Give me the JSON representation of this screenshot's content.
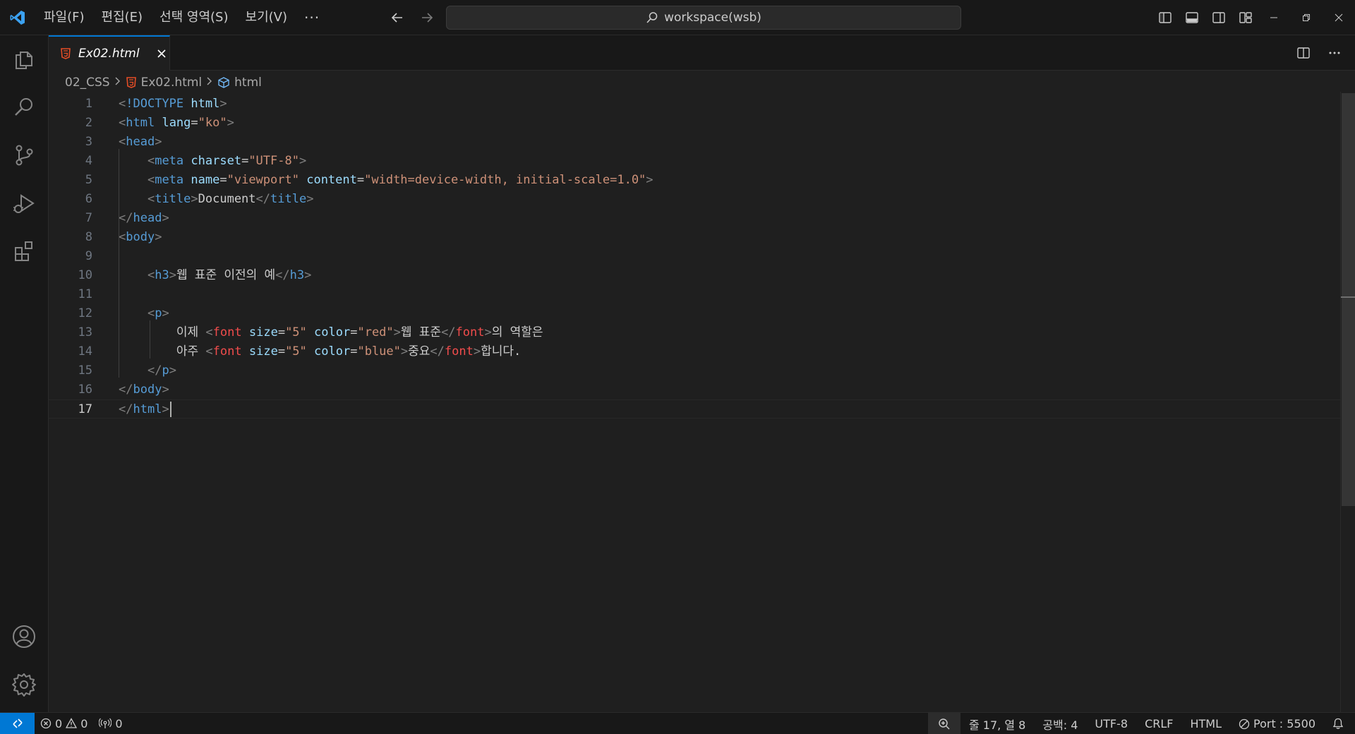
{
  "titlebar": {
    "menu": [
      "파일(F)",
      "편집(E)",
      "선택 영역(S)",
      "보기(V)"
    ],
    "more": "···",
    "search": "workspace(wsb)"
  },
  "tabs": [
    {
      "label": "Ex02.html",
      "icon": "html5-icon",
      "active": true
    }
  ],
  "breadcrumb": [
    "02_CSS",
    "Ex02.html",
    "html"
  ],
  "editor": {
    "current_line": 17,
    "lines": [
      {
        "n": "1"
      },
      {
        "n": "2"
      },
      {
        "n": "3"
      },
      {
        "n": "4"
      },
      {
        "n": "5"
      },
      {
        "n": "6"
      },
      {
        "n": "7"
      },
      {
        "n": "8"
      },
      {
        "n": "9"
      },
      {
        "n": "10"
      },
      {
        "n": "11"
      },
      {
        "n": "12"
      },
      {
        "n": "13"
      },
      {
        "n": "14"
      },
      {
        "n": "15"
      },
      {
        "n": "16"
      },
      {
        "n": "17"
      }
    ],
    "code": [
      [
        [
          "punc",
          "<"
        ],
        [
          "tag",
          "!DOCTYPE"
        ],
        [
          "txt",
          " "
        ],
        [
          "attr",
          "html"
        ],
        [
          "punc",
          ">"
        ]
      ],
      [
        [
          "punc",
          "<"
        ],
        [
          "tag",
          "html"
        ],
        [
          "txt",
          " "
        ],
        [
          "attr",
          "lang"
        ],
        [
          "txt",
          "="
        ],
        [
          "str",
          "\"ko\""
        ],
        [
          "punc",
          ">"
        ]
      ],
      [
        [
          "punc",
          "<"
        ],
        [
          "tag",
          "head"
        ],
        [
          "punc",
          ">"
        ]
      ],
      [
        [
          "txt",
          "    "
        ],
        [
          "punc",
          "<"
        ],
        [
          "tag",
          "meta"
        ],
        [
          "txt",
          " "
        ],
        [
          "attr",
          "charset"
        ],
        [
          "txt",
          "="
        ],
        [
          "str",
          "\"UTF-8\""
        ],
        [
          "punc",
          ">"
        ]
      ],
      [
        [
          "txt",
          "    "
        ],
        [
          "punc",
          "<"
        ],
        [
          "tag",
          "meta"
        ],
        [
          "txt",
          " "
        ],
        [
          "attr",
          "name"
        ],
        [
          "txt",
          "="
        ],
        [
          "str",
          "\"viewport\""
        ],
        [
          "txt",
          " "
        ],
        [
          "attr",
          "content"
        ],
        [
          "txt",
          "="
        ],
        [
          "str",
          "\"width=device-width, initial-scale=1.0\""
        ],
        [
          "punc",
          ">"
        ]
      ],
      [
        [
          "txt",
          "    "
        ],
        [
          "punc",
          "<"
        ],
        [
          "tag",
          "title"
        ],
        [
          "punc",
          ">"
        ],
        [
          "txt",
          "Document"
        ],
        [
          "punc",
          "</"
        ],
        [
          "tag",
          "title"
        ],
        [
          "punc",
          ">"
        ]
      ],
      [
        [
          "punc",
          "</"
        ],
        [
          "tag",
          "head"
        ],
        [
          "punc",
          ">"
        ]
      ],
      [
        [
          "punc",
          "<"
        ],
        [
          "tag",
          "body"
        ],
        [
          "punc",
          ">"
        ]
      ],
      [
        [
          "txt",
          ""
        ]
      ],
      [
        [
          "txt",
          "    "
        ],
        [
          "punc",
          "<"
        ],
        [
          "tag",
          "h3"
        ],
        [
          "punc",
          ">"
        ],
        [
          "txt",
          "웹 표준 이전의 예"
        ],
        [
          "punc",
          "</"
        ],
        [
          "tag",
          "h3"
        ],
        [
          "punc",
          ">"
        ]
      ],
      [
        [
          "txt",
          ""
        ]
      ],
      [
        [
          "txt",
          "    "
        ],
        [
          "punc",
          "<"
        ],
        [
          "tag",
          "p"
        ],
        [
          "punc",
          ">"
        ]
      ],
      [
        [
          "txt",
          "        이제 "
        ],
        [
          "punc",
          "<"
        ],
        [
          "red",
          "font"
        ],
        [
          "txt",
          " "
        ],
        [
          "attr",
          "size"
        ],
        [
          "txt",
          "="
        ],
        [
          "str",
          "\"5\""
        ],
        [
          "txt",
          " "
        ],
        [
          "attr",
          "color"
        ],
        [
          "txt",
          "="
        ],
        [
          "str",
          "\"red\""
        ],
        [
          "punc",
          ">"
        ],
        [
          "txt",
          "웹 표준"
        ],
        [
          "punc",
          "</"
        ],
        [
          "red",
          "font"
        ],
        [
          "punc",
          ">"
        ],
        [
          "txt",
          "의 역할은"
        ]
      ],
      [
        [
          "txt",
          "        아주 "
        ],
        [
          "punc",
          "<"
        ],
        [
          "red",
          "font"
        ],
        [
          "txt",
          " "
        ],
        [
          "attr",
          "size"
        ],
        [
          "txt",
          "="
        ],
        [
          "str",
          "\"5\""
        ],
        [
          "txt",
          " "
        ],
        [
          "attr",
          "color"
        ],
        [
          "txt",
          "="
        ],
        [
          "str",
          "\"blue\""
        ],
        [
          "punc",
          ">"
        ],
        [
          "txt",
          "중요"
        ],
        [
          "punc",
          "</"
        ],
        [
          "red",
          "font"
        ],
        [
          "punc",
          ">"
        ],
        [
          "txt",
          "합니다."
        ]
      ],
      [
        [
          "txt",
          "    "
        ],
        [
          "punc",
          "</"
        ],
        [
          "tag",
          "p"
        ],
        [
          "punc",
          ">"
        ]
      ],
      [
        [
          "punc",
          "</"
        ],
        [
          "tag",
          "body"
        ],
        [
          "punc",
          ">"
        ]
      ],
      [
        [
          "punc",
          "</"
        ],
        [
          "tag",
          "html"
        ],
        [
          "punc",
          ">"
        ]
      ]
    ]
  },
  "statusbar": {
    "errors": "0",
    "warnings": "0",
    "ports": "0",
    "position": "줄 17, 열 8",
    "spaces": "공백: 4",
    "encoding": "UTF-8",
    "eol": "CRLF",
    "language": "HTML",
    "port": "Port : 5500"
  },
  "colors": {
    "accent": "#0078d4",
    "tag": "#569cd6",
    "attr": "#9cdcfe",
    "string": "#ce9178",
    "font_tag": "#f14c4c"
  }
}
